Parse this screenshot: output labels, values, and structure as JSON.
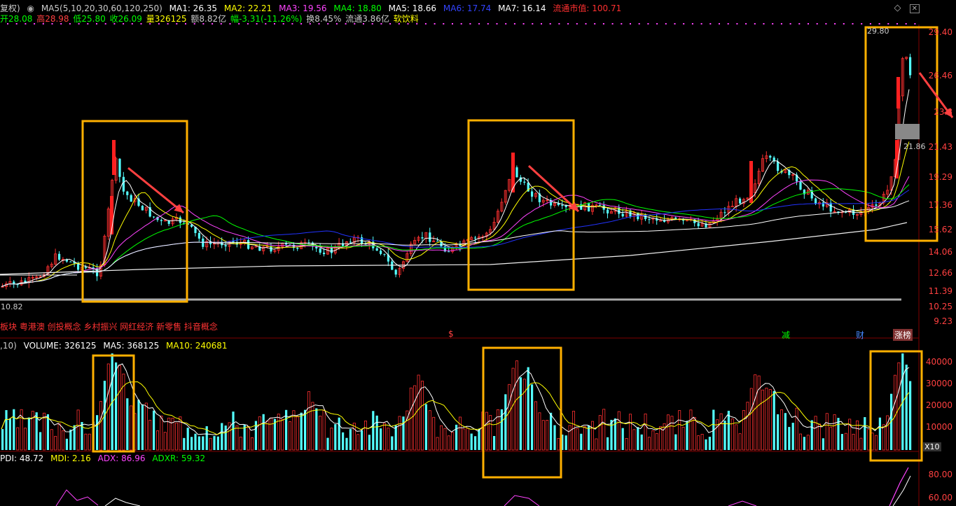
{
  "header": {
    "mode": "复权)",
    "ma_params": "MA5(5,10,20,30,60,120,250)",
    "ma1": "MA1: 26.35",
    "ma2": "MA2: 22.21",
    "ma3": "MA3: 19.56",
    "ma4": "MA4: 18.80",
    "ma5": "MA5: 18.66",
    "ma6": "MA6: 17.74",
    "ma7": "MA7: 16.14",
    "market_cap": "流通市值: 100.71",
    "colors": {
      "ma1": "#ffffff",
      "ma2": "#ffff00",
      "ma3": "#ff44ff",
      "ma4": "#00ff00",
      "ma5": "#ffffff",
      "ma6": "#0000ff",
      "ma7": "#ffffff",
      "market_cap": "#ff3030"
    }
  },
  "quote": {
    "open": "开28.08",
    "high": "高28.98",
    "low": "低25.80",
    "close": "收26.09",
    "volume": "量326125",
    "amount": "额8.82亿",
    "change": "幅-3.31(-11.26%)",
    "turnover": "换8.45%",
    "float": "流通3.86亿",
    "industry": "软饮料"
  },
  "price_axis": [
    "29.40",
    "26.46",
    "23.8",
    "21.43",
    "19.29",
    "17.36",
    "15.62",
    "14.06",
    "12.66",
    "11.39",
    "10.25",
    "9.23"
  ],
  "price_labels": {
    "high": "29.80",
    "low": "10.82",
    "mid": "21.86"
  },
  "concepts": "板块 粤港澳 创投概念 乡村振兴 网红经济 新零售 抖音概念",
  "markers": [
    {
      "text": "$",
      "color": "#ff4040"
    },
    {
      "text": "减",
      "color": "#00ff00"
    },
    {
      "text": "财",
      "color": "#4488ff"
    },
    {
      "text": "涨榜",
      "color": "#ffffff"
    }
  ],
  "volume": {
    "params": ",10)",
    "label": "VOLUME: 326125",
    "ma5": "MA5: 368125",
    "ma10": "MA10: 240681",
    "axis": [
      "40000",
      "30000",
      "20000",
      "10000"
    ],
    "unit": "X10"
  },
  "dmi": {
    "pdi": "PDI: 48.72",
    "mdi": "MDI: 2.16",
    "adx": "ADX: 86.96",
    "adxr": "ADXR: 59.32",
    "axis": [
      "80.00",
      "60.00"
    ]
  },
  "icons": {
    "diamond": "diamond-icon",
    "close": "close-icon"
  }
}
